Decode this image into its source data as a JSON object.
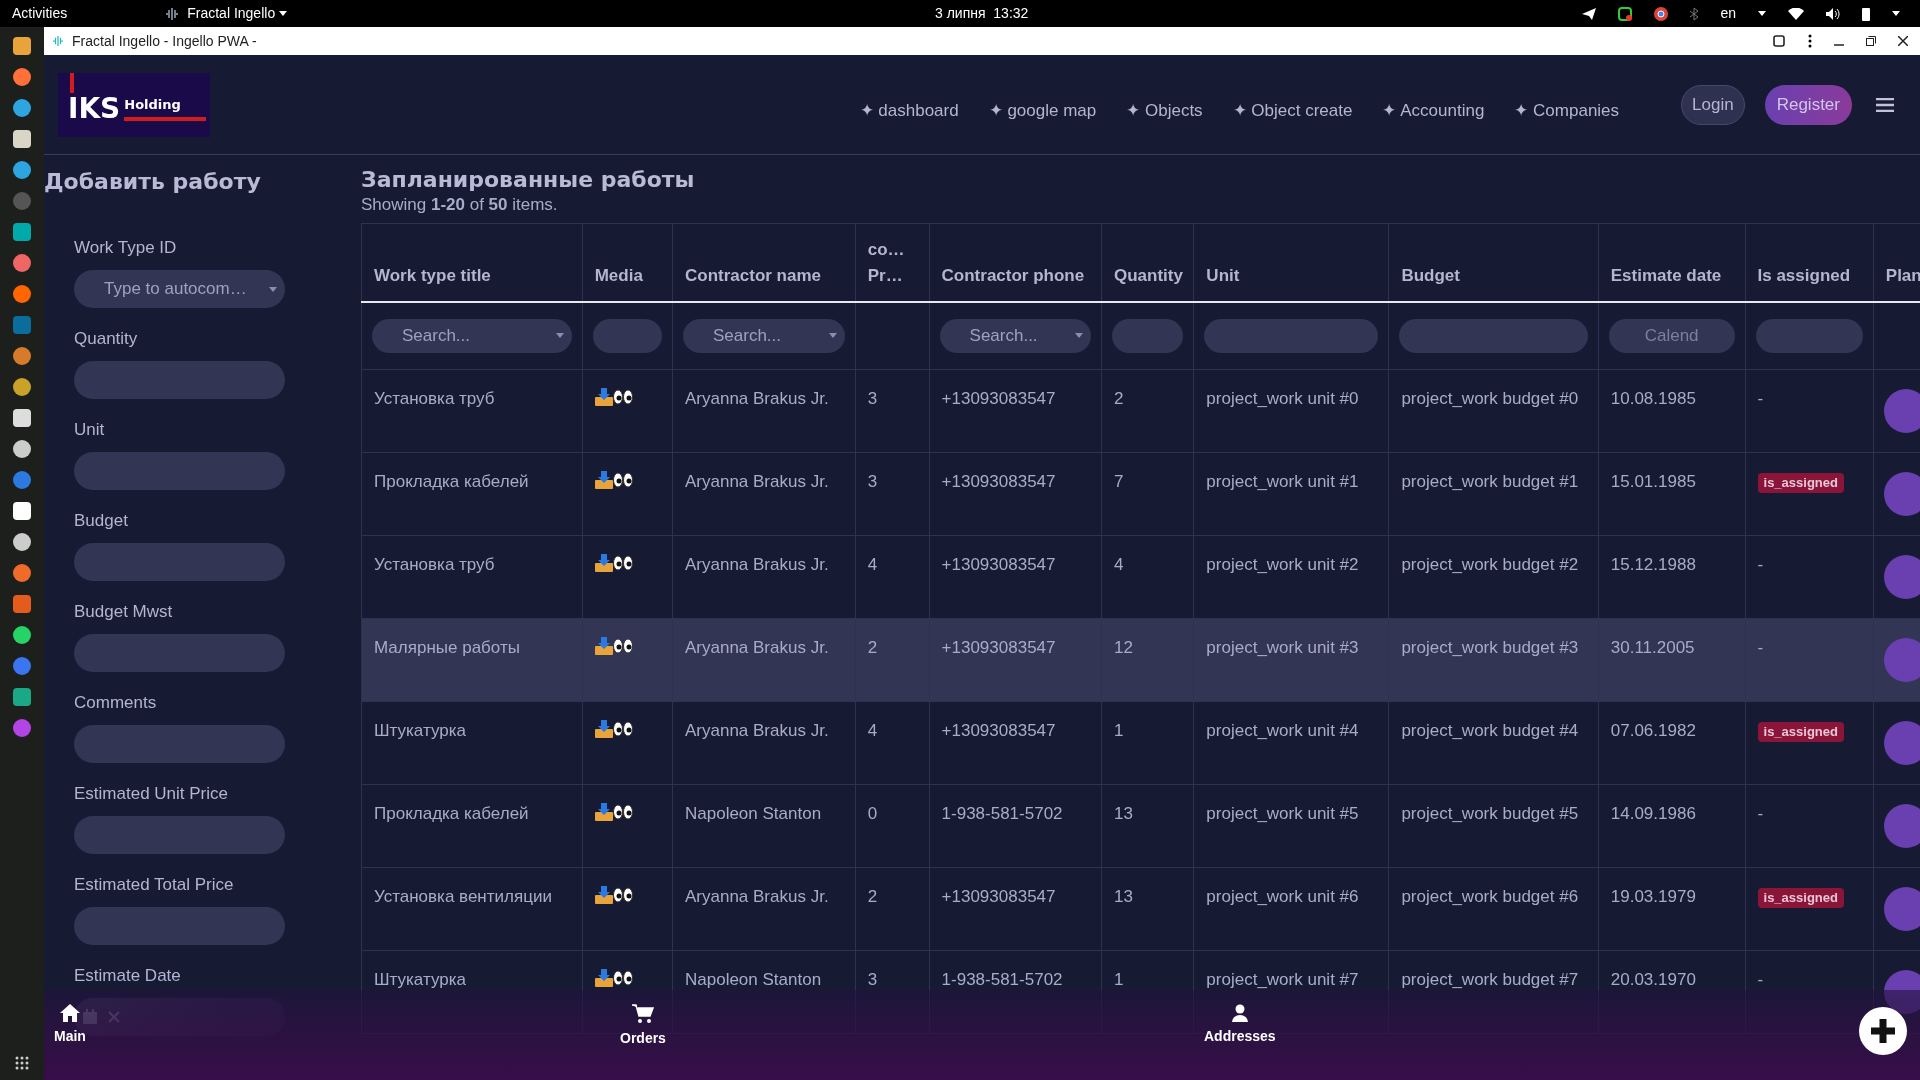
{
  "system_bar": {
    "activities": "Activities",
    "app": "Fractal Ingello",
    "clock": "3 липня  13:32",
    "language": "en"
  },
  "browser": {
    "title": "Fractal Ingello - Ingello PWA -"
  },
  "header": {
    "logo": {
      "main": "IKS",
      "sub": "Holding"
    },
    "nav": [
      {
        "label": "✦ dashboard"
      },
      {
        "label": "✦ google map"
      },
      {
        "label": "✦ Objects"
      },
      {
        "label": "✦ Object create"
      },
      {
        "label": "✦ Accounting"
      },
      {
        "label": "✦ Companies"
      }
    ],
    "login": "Login",
    "register": "Register"
  },
  "form": {
    "title": "Добавить работу",
    "fields": [
      {
        "label": "Work Type ID",
        "kind": "select",
        "placeholder": "Type to autocom…"
      },
      {
        "label": "Quantity",
        "kind": "input"
      },
      {
        "label": "Unit",
        "kind": "input"
      },
      {
        "label": "Budget",
        "kind": "input"
      },
      {
        "label": "Budget Mwst",
        "kind": "input"
      },
      {
        "label": "Comments",
        "kind": "input"
      },
      {
        "label": "Estimated Unit Price",
        "kind": "input"
      },
      {
        "label": "Estimated Total Price",
        "kind": "input"
      },
      {
        "label": "Estimate Date",
        "kind": "date"
      }
    ]
  },
  "table": {
    "title": "Запланированные работы",
    "summary": "Showing **1-20** of **50** items.",
    "columns": [
      {
        "label": "Work type title",
        "kind": "select",
        "placeholder": "Search..."
      },
      {
        "label": "Media",
        "kind": "input"
      },
      {
        "label": "Contractor name",
        "kind": "select",
        "placeholder": "Search..."
      },
      {
        "label": "co…\nPr…",
        "kind": "none"
      },
      {
        "label": "Contractor phone",
        "kind": "select",
        "placeholder": "Search..."
      },
      {
        "label": "Quantity",
        "kind": "input"
      },
      {
        "label": "Unit",
        "kind": "input"
      },
      {
        "label": "Budget",
        "kind": "input"
      },
      {
        "label": "Estimate date",
        "kind": "date",
        "placeholder": "Calend"
      },
      {
        "label": "Is assigned",
        "kind": "input"
      },
      {
        "label": "Plan",
        "kind": "none"
      }
    ],
    "rows": [
      {
        "title": "Установка труб",
        "contractor": "Aryanna Brakus Jr.",
        "column_4": "3",
        "phone": "+13093083547",
        "quantity": "2",
        "unit": "project_work unit #0",
        "budget": "project_work budget #0",
        "date": "10.08.1985",
        "assigned": false,
        "assigned_label": "-",
        "selected": false
      },
      {
        "title": "Прокладка кабелей",
        "contractor": "Aryanna Brakus Jr.",
        "column_4": "3",
        "phone": "+13093083547",
        "quantity": "7",
        "unit": "project_work unit #1",
        "budget": "project_work budget #1",
        "date": "15.01.1985",
        "assigned": true,
        "assigned_label": "is_assigned",
        "selected": false
      },
      {
        "title": "Установка труб",
        "contractor": "Aryanna Brakus Jr.",
        "column_4": "4",
        "phone": "+13093083547",
        "quantity": "4",
        "unit": "project_work unit #2",
        "budget": "project_work budget #2",
        "date": "15.12.1988",
        "assigned": false,
        "assigned_label": "-",
        "selected": false
      },
      {
        "title": "Малярные работы",
        "contractor": "Aryanna Brakus Jr.",
        "column_4": "2",
        "phone": "+13093083547",
        "quantity": "12",
        "unit": "project_work unit #3",
        "budget": "project_work budget #3",
        "date": "30.11.2005",
        "assigned": false,
        "assigned_label": "-",
        "selected": true
      },
      {
        "title": "Штукатурка",
        "contractor": "Aryanna Brakus Jr.",
        "column_4": "4",
        "phone": "+13093083547",
        "quantity": "1",
        "unit": "project_work unit #4",
        "budget": "project_work budget #4",
        "date": "07.06.1982",
        "assigned": true,
        "assigned_label": "is_assigned",
        "selected": false
      },
      {
        "title": "Прокладка кабелей",
        "contractor": "Napoleon Stanton",
        "column_4": "0",
        "phone": "1-938-581-5702",
        "quantity": "13",
        "unit": "project_work unit #5",
        "budget": "project_work budget #5",
        "date": "14.09.1986",
        "assigned": false,
        "assigned_label": "-",
        "selected": false
      },
      {
        "title": "Установка вентиляции",
        "contractor": "Aryanna Brakus Jr.",
        "column_4": "2",
        "phone": "+13093083547",
        "quantity": "13",
        "unit": "project_work unit #6",
        "budget": "project_work budget #6",
        "date": "19.03.1979",
        "assigned": true,
        "assigned_label": "is_assigned",
        "selected": false
      },
      {
        "title": "Штукатурка",
        "contractor": "Napoleon Stanton",
        "column_4": "3",
        "phone": "1-938-581-5702",
        "quantity": "1",
        "unit": "project_work unit #7",
        "budget": "project_work budget #7",
        "date": "20.03.1970",
        "assigned": false,
        "assigned_label": "-",
        "selected": false
      }
    ]
  },
  "bottom_nav": [
    {
      "label": "Main",
      "kind": "home"
    },
    {
      "label": "Orders",
      "kind": "cart"
    },
    {
      "label": "Addresses",
      "kind": "person"
    }
  ]
}
